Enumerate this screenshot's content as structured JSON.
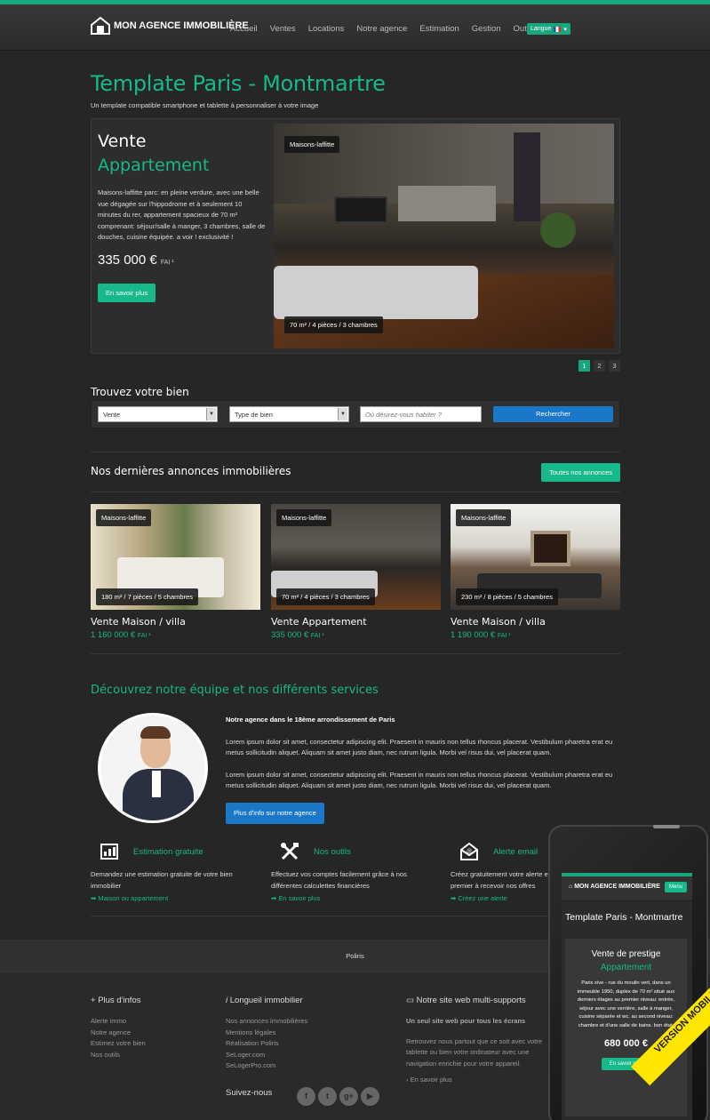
{
  "brand": {
    "name": "MON AGENCE IMMOBILIÈRE"
  },
  "nav": {
    "items": [
      "Accueil",
      "Ventes",
      "Locations",
      "Notre agence",
      "Estimation",
      "Gestion",
      "Outils"
    ],
    "lang": "Langue"
  },
  "hero": {
    "title": "Template Paris - Montmartre",
    "subtitle": "Un template compatible smartphone et tablette à personnaliser à votre image"
  },
  "slide": {
    "type": "Vente",
    "subtype": "Appartement",
    "desc": "Maisons-laffitte parc: en pleine verdure, avec une belle vue dégagée sur l'hippodrome et à seulement 10 minutes du rer, appartement spacieux de 70 m² comprenant: séjour/salle à manger, 3 chambres, salle de douches, cuisine équipée. a voir ! exclusivité !",
    "price": "335 000 €",
    "fai": "FAI ¹",
    "cta": "En savoir plus",
    "location": "Maisons-laffitte",
    "details": "70 m² / 4 pièces / 3 chambres"
  },
  "pager": [
    "1",
    "2",
    "3"
  ],
  "search": {
    "title": "Trouvez votre bien",
    "select1": "Vente",
    "select2": "Type de bien",
    "placeholder": "Où désirez-vous habiter ?",
    "button": "Rechercher"
  },
  "listings": {
    "title": "Nos dernières annonces immobilières",
    "all_button": "Toutes nos annonces",
    "cards": [
      {
        "location": "Maisons-laffitte",
        "details": "180 m² / 7 pièces / 5 chambres",
        "title": "Vente Maison / villa",
        "price": "1 160 000 €",
        "fai": "FAI ¹"
      },
      {
        "location": "Maisons-laffitte",
        "details": "70 m² / 4 pièces / 3 chambres",
        "title": "Vente Appartement",
        "price": "335 000 €",
        "fai": "FAI ¹"
      },
      {
        "location": "Maisons-laffitte",
        "details": "230 m² / 8 pièces / 5 chambres",
        "title": "Vente Maison / villa",
        "price": "1 190 000 €",
        "fai": "FAI ¹"
      }
    ]
  },
  "team": {
    "title": "Découvrez notre équipe et nos différents services",
    "heading": "Notre agence dans le 18ème arrondissement de Paris",
    "p1": "Lorem ipsum dolor sit amet, consectetur adipiscing elit. Praesent in mauris non tellus rhoncus placerat. Vestibulum pharetra erat eu metus sollicitudin aliquet. Aliquam sit amet justo diam, nec rutrum ligula. Morbi vel risus dui, vel placerat quam.",
    "p2": "Lorem ipsum dolor sit amet, consectetur adipiscing elit. Praesent in mauris non tellus rhoncus placerat. Vestibulum pharetra erat eu metus sollicitudin aliquet. Aliquam sit amet justo diam, nec rutrum ligula. Morbi vel risus dui, vel placerat quam.",
    "button": "Plus d'info sur notre agence"
  },
  "services": [
    {
      "title": "Estimation gratuite",
      "desc": "Demandez une estimation gratuite de votre bien immobilier",
      "link": "Maison ou appartement",
      "icon": "estimation-icon"
    },
    {
      "title": "Nos outils",
      "desc": "Effectuez vos comptes facilement grâce à nos différentes calculettes financières",
      "link": "En savoir plus",
      "icon": "tools-icon"
    },
    {
      "title": "Alerte email",
      "desc": "Créez gratuitement votre alerte email et soyez le premier à recevoir nos offres",
      "link": "Créez une alerte",
      "icon": "email-icon"
    }
  ],
  "footer": {
    "credit": "Poliris",
    "col1": {
      "title": "Plus d'infos",
      "items": [
        "Alerte immo",
        "Notre agence",
        "Estimez votre bien",
        "Nos outils"
      ]
    },
    "col2": {
      "title": "Longueil immobilier",
      "items": [
        "Nos annonces immobilières",
        "Mentions légales",
        "Réalisation Poliris",
        "SeLoger.com",
        "SeLogerPro.com"
      ],
      "follow": "Suivez-nous"
    },
    "col3": {
      "title": "Notre site web multi-supports",
      "bold": "Un seul site web pour tous les écrans",
      "text": "Retrouvez nous partout que ce soit avec votre tablette ou bien votre ordinateur avec une navigation enrichie pour votre appareil.",
      "link": "En savoir plus"
    }
  },
  "mobile": {
    "brand": "MON AGENCE IMMOBILIÈRE",
    "menu": "Menu",
    "title": "Template Paris - Montmartre",
    "h1": "Vente de prestige",
    "h2": "Appartement",
    "desc": "Paris xive - rue du moulin vert, dans un immeuble 1950, duplex de 70 m² situé aux derniers étages au premier niveau: entrée, séjour avec une verrière, salle à manger, cuisine séparée et wc. au second niveau: chambre et d'une salle de bains. bon état.",
    "price": "680 000 €",
    "button": "En savoir plus",
    "ribbon": "VERSION MOBILE"
  },
  "colors": {
    "accent": "#17a67e",
    "blue": "#1b78c8"
  }
}
